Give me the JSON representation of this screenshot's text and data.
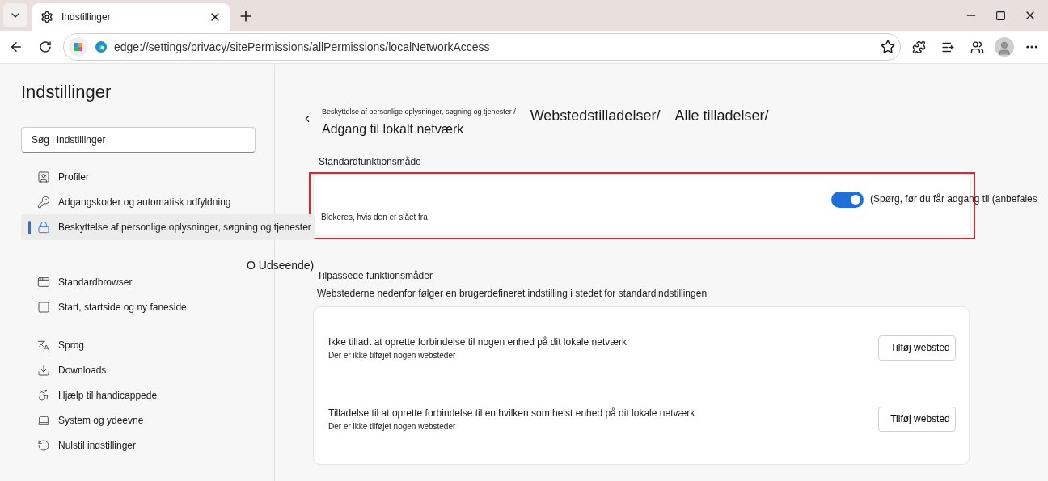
{
  "browser": {
    "tab": {
      "title": "Indstillinger",
      "selected": true
    },
    "address": "edge://settings/privacy/sitePermissions/allPermissions/localNetworkAccess"
  },
  "sidebar": {
    "title": "Indstillinger",
    "search": {
      "placeholder": "Søg i indstillinger"
    },
    "groups": [
      [
        {
          "label": "Profiler",
          "selected": false
        },
        {
          "label": "Adgangskoder og automatisk udfyldning",
          "selected": false
        },
        {
          "label": "Beskyttelse af personlige oplysninger, søgning og tjenester",
          "selected": true
        }
      ],
      [
        {
          "label": "Standardbrowser",
          "selected": false
        },
        {
          "label": "Start, startside og ny faneside",
          "selected": false
        }
      ],
      [
        {
          "label": "Sprog",
          "selected": false
        },
        {
          "label": "Downloads",
          "selected": false
        },
        {
          "label": "Hjælp til handicappede",
          "selected": false
        },
        {
          "label": "System og ydeevne",
          "selected": false
        },
        {
          "label": "Nulstil indstillinger",
          "selected": false
        }
      ]
    ]
  },
  "stray_text": "O Udseende)",
  "breadcrumb": {
    "small": "Beskyttelse af personlige oplysninger, søgning og tjenester /",
    "large": [
      "Webstedstilladelser/",
      "Alle tilladelser/"
    ],
    "title": "Adgang til lokalt netværk"
  },
  "default_section": {
    "heading": "Standardfunktionsmåde",
    "toggle_label": "(Spørg, før du får adgang til (anbefales",
    "on": true,
    "description": "Blokeres, hvis den er slået fra",
    "highlighted": true
  },
  "custom_section": {
    "heading": "Tilpassede funktionsmåder",
    "description": "Webstederne nedenfor følger en brugerdefineret indstilling i stedet for standardindstillingen",
    "rows": [
      {
        "title": "Ikke tilladt at oprette forbindelse til nogen enhed på dit lokale netværk",
        "subtitle": "Der er ikke tilføjet nogen websteder",
        "button": "Tilføj websted"
      },
      {
        "title": "Tilladelse til at oprette forbindelse til en hvilken som helst enhed på dit lokale netværk",
        "subtitle": "Der er ikke tilføjet nogen websteder",
        "button": "Tilføj websted"
      }
    ]
  }
}
